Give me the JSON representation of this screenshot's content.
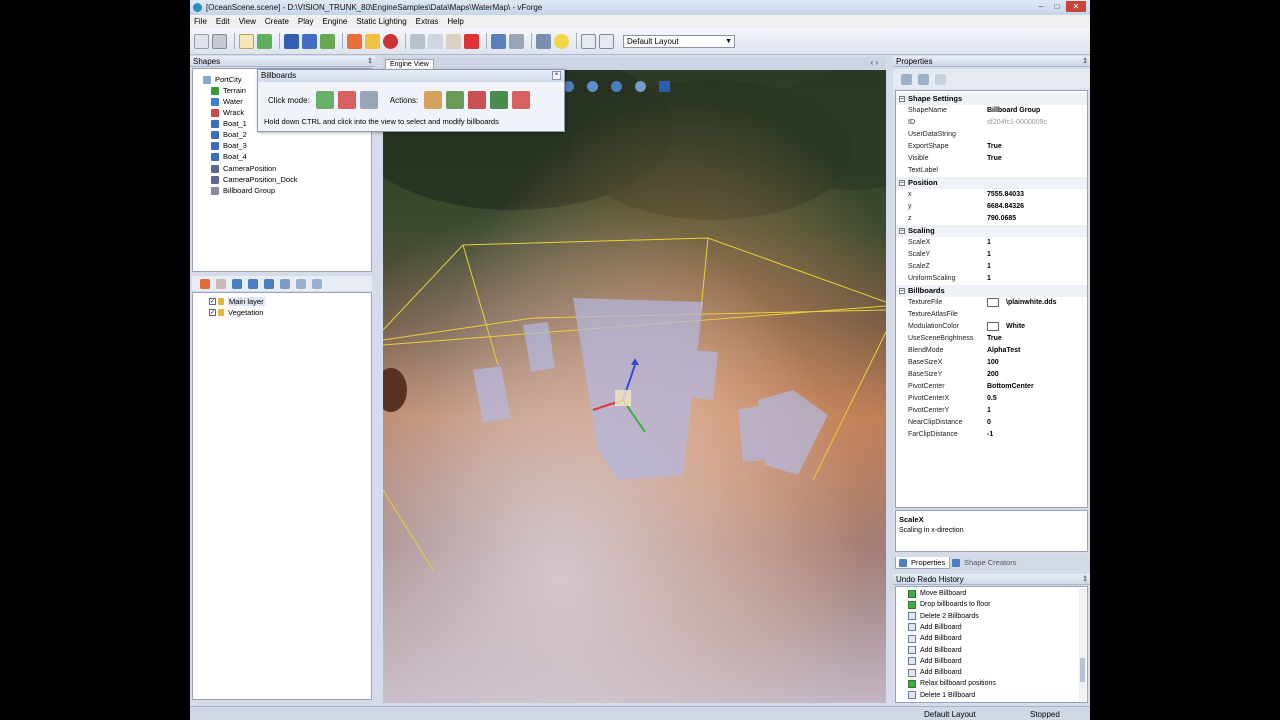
{
  "window": {
    "title": "[OceanScene.scene] - D:\\VISION_TRUNK_80\\EngineSamples\\Data\\Maps\\WaterMap\\ - vForge"
  },
  "menu": [
    "File",
    "Edit",
    "View",
    "Create",
    "Play",
    "Engine",
    "Static Lighting",
    "Extras",
    "Help"
  ],
  "toolbar": {
    "layout_value": "Default Layout"
  },
  "shapes_panel": {
    "title": "Shapes",
    "items": [
      "PortCity",
      "Terrain",
      "Water",
      "Wrack",
      "Boat_1",
      "Boat_2",
      "Boat_3",
      "Boat_4",
      "CameraPosition",
      "CameraPosition_Dock",
      "Billboard Group"
    ]
  },
  "layers_panel": {
    "items": [
      "Main layer",
      "Vegetation"
    ]
  },
  "engine_view": {
    "tab_label": "Engine View",
    "nav": "‹ ›"
  },
  "billboards_dialog": {
    "title": "Billboards",
    "close_glyph": "×",
    "click_mode_label": "Click mode:",
    "actions_label": "Actions:",
    "hint": "Hold down CTRL and click into the view to select and modify billboards"
  },
  "properties": {
    "title": "Properties",
    "categories": [
      {
        "name": "Shape Settings",
        "rows": [
          {
            "k": "ShapeName",
            "v": "Billboard Group"
          },
          {
            "k": "ID",
            "v": "df204fc1-0000009c",
            "muted": true
          },
          {
            "k": "UserDataString",
            "v": ""
          },
          {
            "k": "ExportShape",
            "v": "True"
          },
          {
            "k": "Visible",
            "v": "True"
          },
          {
            "k": "TextLabel",
            "v": ""
          }
        ]
      },
      {
        "name": "Position",
        "rows": [
          {
            "k": "x",
            "v": "7555.84033"
          },
          {
            "k": "y",
            "v": "6684.84326"
          },
          {
            "k": "z",
            "v": "790.0685"
          }
        ]
      },
      {
        "name": "Scaling",
        "rows": [
          {
            "k": "ScaleX",
            "v": "1"
          },
          {
            "k": "ScaleY",
            "v": "1"
          },
          {
            "k": "ScaleZ",
            "v": "1"
          },
          {
            "k": "UniformScaling",
            "v": "1"
          }
        ]
      },
      {
        "name": "Billboards",
        "rows": [
          {
            "k": "TextureFile",
            "v": "\\plainwhite.dds",
            "swatch": true
          },
          {
            "k": "TextureAtlasFile",
            "v": ""
          },
          {
            "k": "ModulationColor",
            "v": "White",
            "swatch": true
          },
          {
            "k": "UseSceneBrightness",
            "v": "True"
          },
          {
            "k": "BlendMode",
            "v": "AlphaTest"
          },
          {
            "k": "BaseSizeX",
            "v": "100"
          },
          {
            "k": "BaseSizeY",
            "v": "200"
          },
          {
            "k": "PivotCenter",
            "v": "BottomCenter"
          },
          {
            "k": "PivotCenterX",
            "v": "0.5"
          },
          {
            "k": "PivotCenterY",
            "v": "1"
          },
          {
            "k": "NearClipDistance",
            "v": "0"
          },
          {
            "k": "FarClipDistance",
            "v": "-1"
          }
        ]
      }
    ],
    "description_title": "ScaleX",
    "description_text": "Scaling in x-direction",
    "tabs": [
      "Properties",
      "Shape Creators"
    ]
  },
  "undo_redo": {
    "title": "Undo Redo History",
    "items": [
      {
        "label": "Move Billboard",
        "green": true
      },
      {
        "label": "Drop billboards to floor",
        "green": true
      },
      {
        "label": "Delete 2 Billboards",
        "green": false
      },
      {
        "label": "Add Billboard",
        "green": false
      },
      {
        "label": "Add Billboard",
        "green": false
      },
      {
        "label": "Add Billboard",
        "green": false
      },
      {
        "label": "Add Billboard",
        "green": false
      },
      {
        "label": "Add Billboard",
        "green": false
      },
      {
        "label": "Relax billboard positions",
        "green": true
      },
      {
        "label": "Delete 1 Billboard",
        "green": false
      }
    ]
  },
  "status": {
    "layout": "Default Layout",
    "state": "Stopped"
  },
  "glyphs": {
    "minimize": "–",
    "maximize": "□",
    "close": "✕",
    "pin": "‡",
    "dropdown": "▼",
    "check": "✓",
    "minus": "–"
  },
  "colors": {
    "accent": "#4a7fc0",
    "selection_box": "#e8d23a",
    "billboard": "#b4b8e0"
  }
}
